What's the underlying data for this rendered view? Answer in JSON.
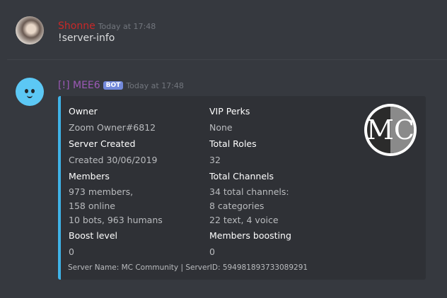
{
  "messages": [
    {
      "author": "Shonne",
      "author_color": "#c82828",
      "timestamp": "Today at 17:48",
      "content": "!server-info",
      "avatar_icon": "user-photo-avatar"
    },
    {
      "author": "[!] MEE6",
      "author_color": "#9b59b6",
      "bot_tag": "BOT",
      "timestamp": "Today at 17:48",
      "avatar_icon": "mee6-face-avatar",
      "embed": {
        "accent_color": "#3fb3e8",
        "thumbnail_icon": "mc-community-logo",
        "thumbnail_text": "MC",
        "fields": [
          {
            "name": "Owner",
            "value": "Zoom Owner#6812"
          },
          {
            "name": "VIP Perks",
            "value": "None"
          },
          {
            "name": "Server Created",
            "value": "Created 30/06/2019"
          },
          {
            "name": "Total Roles",
            "value": "32"
          },
          {
            "name": "Members",
            "lines": [
              "973 members,",
              "158 online",
              "10 bots, 963 humans"
            ]
          },
          {
            "name": "Total Channels",
            "lines": [
              "34 total channels:",
              "8 categories",
              "22 text, 4 voice"
            ]
          },
          {
            "name": "Boost level",
            "value": "0"
          },
          {
            "name": "Members boosting",
            "value": "0"
          }
        ],
        "footer": "Server Name: MC Community | ServerID: 594981893733089291"
      }
    }
  ]
}
